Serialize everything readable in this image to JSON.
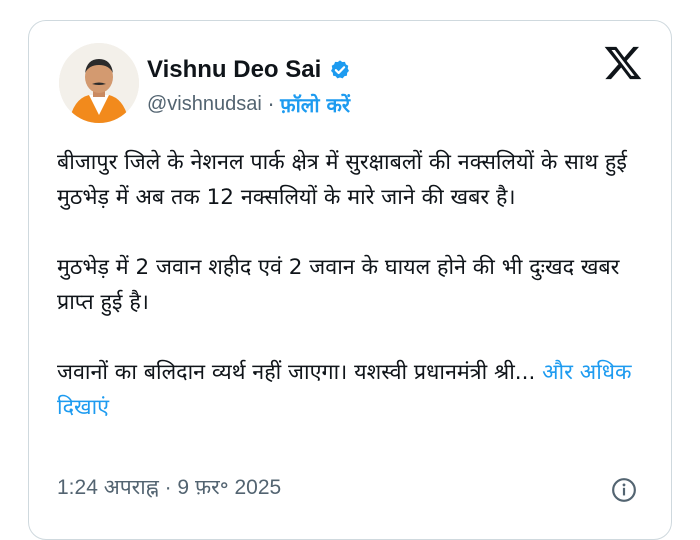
{
  "user": {
    "name": "Vishnu Deo Sai",
    "handle": "@vishnudsai",
    "separator": "·",
    "follow_label": "फ़ॉलो करें",
    "verified_color": "#1d9bf0"
  },
  "tweet": {
    "paragraph1": "बीजापुर जिले के नेशनल पार्क क्षेत्र में सुरक्षाबलों की नक्सलियों के साथ हुई मुठभेड़ में अब तक 12 नक्सलियों के मारे जाने की खबर है।",
    "paragraph2": "मुठभेड़ में 2 जवान शहीद एवं 2 जवान के घायल होने की भी दुःखद खबर प्राप्त हुई है।",
    "paragraph3": "जवानों का बलिदान व्यर्थ नहीं जाएगा। यशस्वी प्रधानमंत्री श्री...",
    "show_more": "और अधिक दिखाएं",
    "timestamp": "1:24 अपराह्न · 9 फ़र॰ 2025"
  },
  "icons": {
    "logo": "x-logo-icon",
    "info": "info-icon",
    "verified": "verified-badge-icon"
  },
  "colors": {
    "link": "#1d9bf0",
    "text": "#0f1419",
    "muted": "#536471",
    "border": "#cfd9de"
  }
}
